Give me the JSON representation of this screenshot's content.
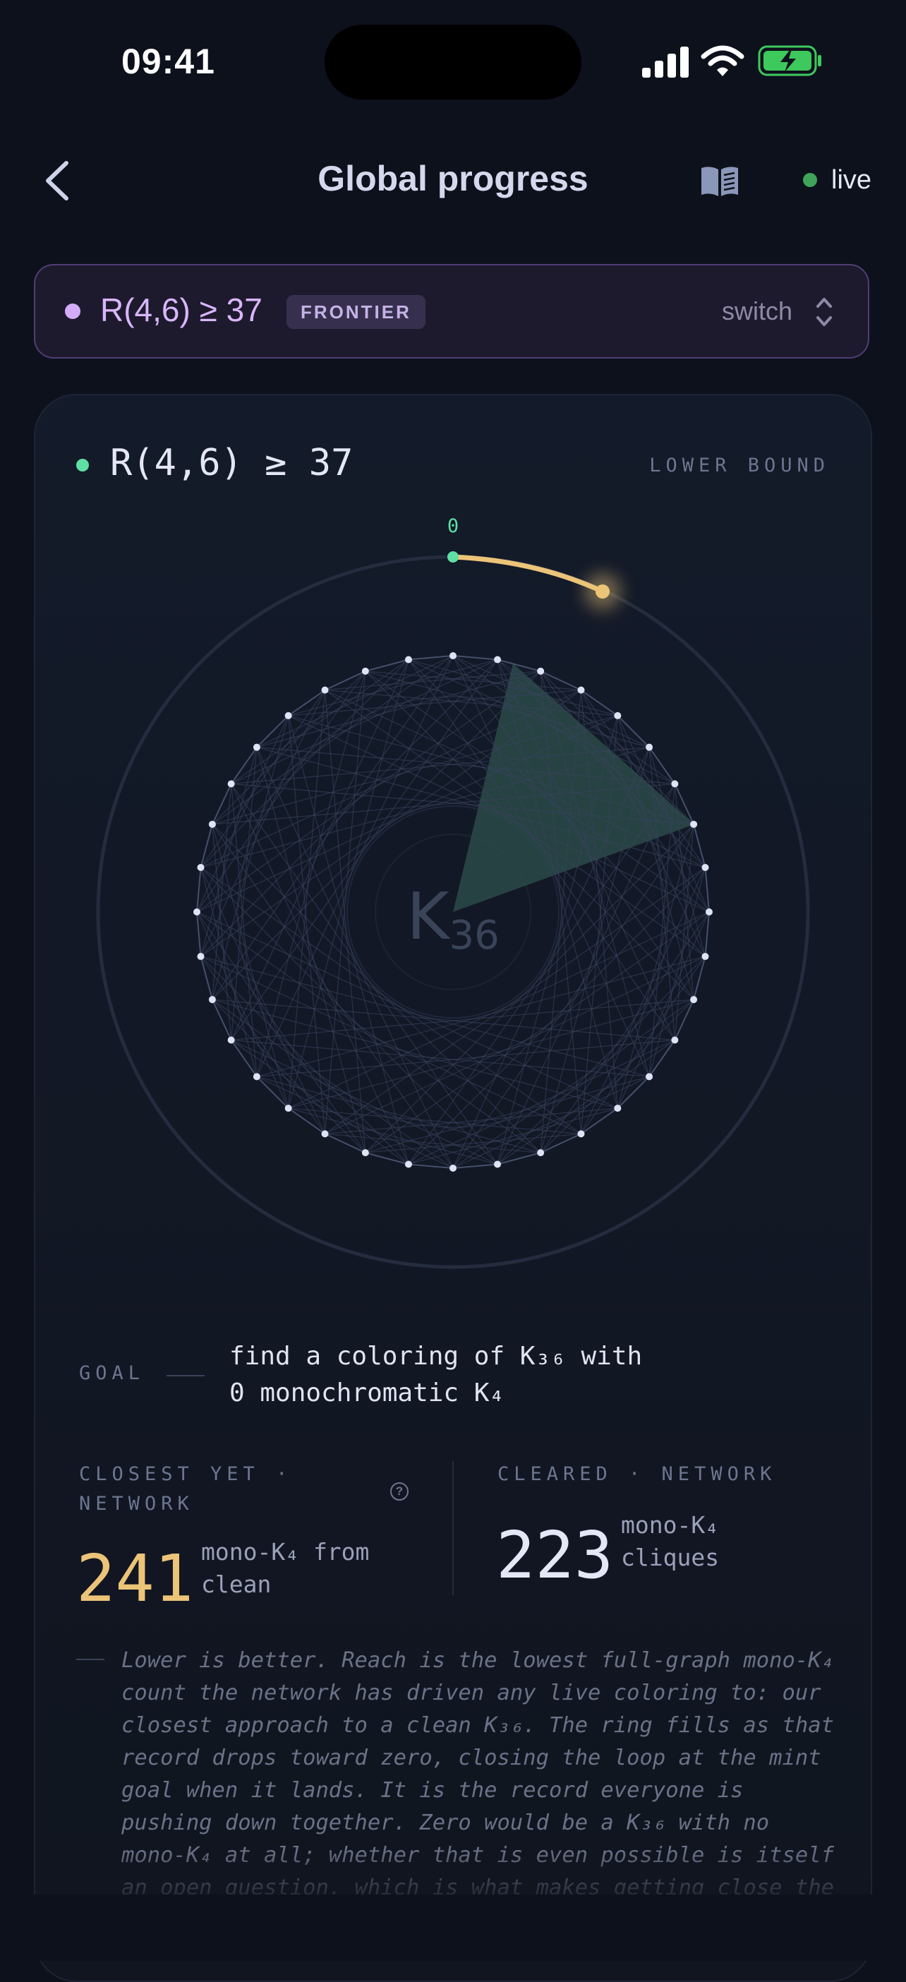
{
  "status_bar": {
    "time": "09:41",
    "battery": "charging"
  },
  "header": {
    "title": "Global progress",
    "back_icon": "chevron-left-icon",
    "guide_icon": "book-icon",
    "live_label": "live",
    "live_color": "#3fa45a"
  },
  "selector": {
    "problem": "R(4,6) ≥ 37",
    "badge": "FRONTIER",
    "switch_label": "switch",
    "accent": "#d3acf7"
  },
  "card": {
    "title": "R(4,6) ≥ 37",
    "bound_label": "LOWER BOUND",
    "graph_label_main": "K",
    "graph_label_sub": "36",
    "vertex_count": 36,
    "ring_start_label": "0",
    "ring_color": "#ecc478",
    "goal_color": "#5ee0a4"
  },
  "goal": {
    "label": "GOAL",
    "text_line1": "find a coloring of K₃₆ with",
    "text_line2": "0 monochromatic K₄"
  },
  "stats": {
    "closest": {
      "label_line1": "CLOSEST YET ·",
      "label_line2": "NETWORK",
      "value": "241",
      "unit_line1": "mono-K₄ from",
      "unit_line2": "clean"
    },
    "cleared": {
      "label": "CLEARED · NETWORK",
      "value": "223",
      "unit_line1": "mono-K₄",
      "unit_line2": "cliques"
    }
  },
  "explanation": "Lower is better. Reach is the lowest full-graph mono-K₄ count the network has driven any live coloring to: our closest approach to a clean K₃₆. The ring fills as that record drops toward zero, closing the loop at the mint goal when it lands. It is the record everyone is pushing down together. Zero would be a K₃₆ with no mono-K₄ at all; whether that is even possible is itself an open question, which is what makes getting close the"
}
